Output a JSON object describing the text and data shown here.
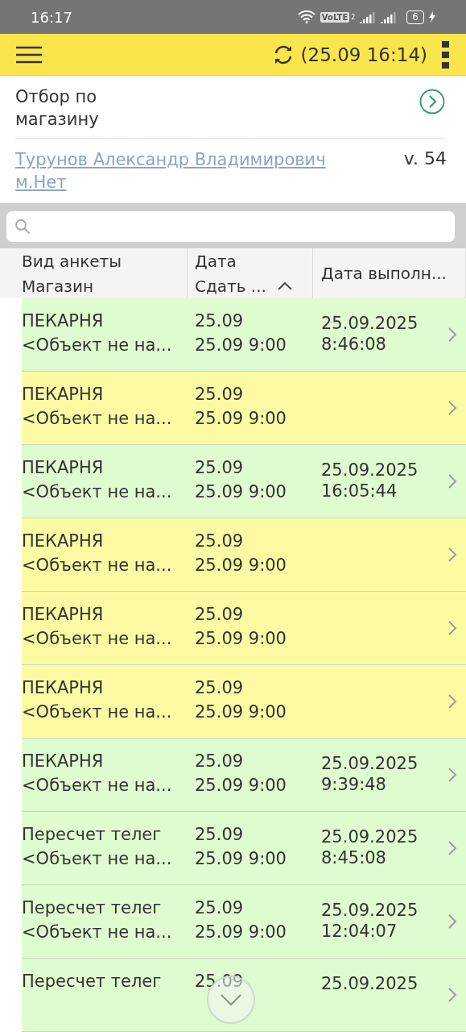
{
  "status_bar": {
    "time": "16:17",
    "volte": "VoLTE",
    "sim": "2",
    "battery": "6"
  },
  "toolbar": {
    "sync_time": "(25.09 16:14)"
  },
  "filter": {
    "label": "Отбор по магазину"
  },
  "user": {
    "name": "Турунов Александр Владимирович м.Нет",
    "version": "v. 54"
  },
  "table": {
    "columns": [
      {
        "top": "Вид анкеты",
        "bottom": "Магазин"
      },
      {
        "top": "Дата",
        "bottom": "Сдать ...",
        "sorted": true
      },
      {
        "top": "Дата выполн..."
      }
    ],
    "rows": [
      {
        "color": "#dffbd0",
        "type": "ПЕКАРНЯ",
        "shop": "<Объект не на...",
        "date": "25.09",
        "due": "25.09 9:00",
        "done_date": "25.09.2025",
        "done_time": "8:46:08"
      },
      {
        "color": "#fdfaa4",
        "type": "ПЕКАРНЯ",
        "shop": "<Объект не на...",
        "date": "25.09",
        "due": "25.09 9:00"
      },
      {
        "color": "#dffbd0",
        "type": "ПЕКАРНЯ",
        "shop": "<Объект не на...",
        "date": "25.09",
        "due": "25.09 9:00",
        "done_date": "25.09.2025",
        "done_time": "16:05:44"
      },
      {
        "color": "#fdfaa4",
        "type": "ПЕКАРНЯ",
        "shop": "<Объект не на...",
        "date": "25.09",
        "due": "25.09 9:00"
      },
      {
        "color": "#fdfaa4",
        "type": "ПЕКАРНЯ",
        "shop": "<Объект не на...",
        "date": "25.09",
        "due": "25.09 9:00"
      },
      {
        "color": "#fdfaa4",
        "type": "ПЕКАРНЯ",
        "shop": "<Объект не на...",
        "date": "25.09",
        "due": "25.09 9:00"
      },
      {
        "color": "#dffbd0",
        "type": "ПЕКАРНЯ",
        "shop": "<Объект не на...",
        "date": "25.09",
        "due": "25.09 9:00",
        "done_date": "25.09.2025",
        "done_time": "9:39:48"
      },
      {
        "color": "#dffbd0",
        "type": "Пересчет телег",
        "shop": "<Объект не на...",
        "date": "25.09",
        "due": "25.09 9:00",
        "done_date": "25.09.2025",
        "done_time": "8:45:08"
      },
      {
        "color": "#dffbd0",
        "type": "Пересчет телег",
        "shop": "<Объект не на...",
        "date": "25.09",
        "due": "25.09 9:00",
        "done_date": "25.09.2025",
        "done_time": "12:04:07"
      },
      {
        "color": "#dffbd0",
        "type": "Пересчет телег",
        "date": "25.09",
        "done_date": "25.09.2025"
      }
    ]
  }
}
